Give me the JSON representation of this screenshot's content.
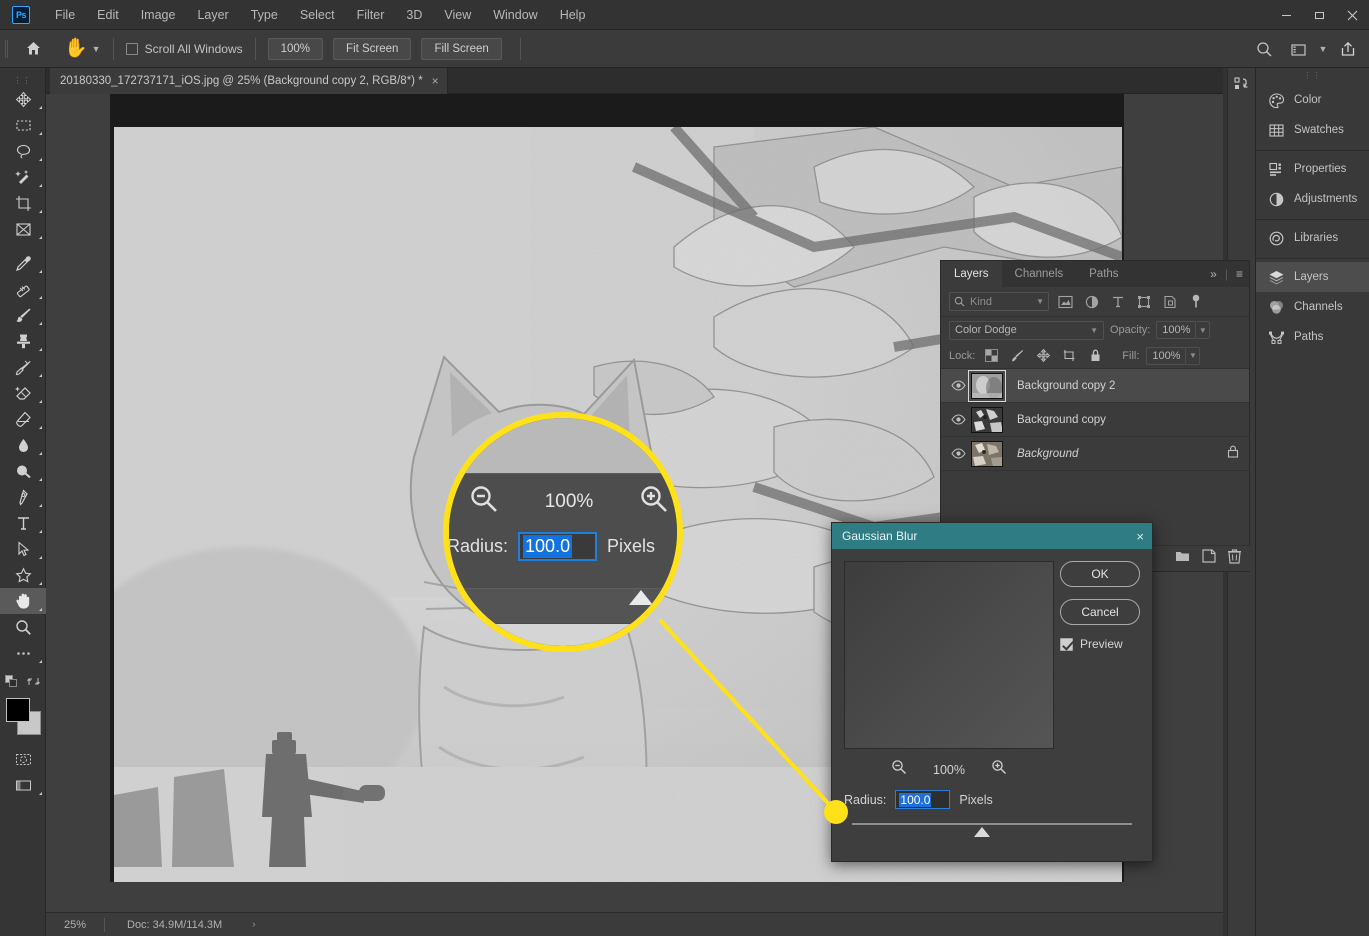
{
  "app": {
    "name": "Adobe Photoshop",
    "logo_text": "Ps"
  },
  "menubar": {
    "items": [
      "File",
      "Edit",
      "Image",
      "Layer",
      "Type",
      "Select",
      "Filter",
      "3D",
      "View",
      "Window",
      "Help"
    ],
    "window_controls": [
      "minimize",
      "maximize",
      "close"
    ]
  },
  "options_bar": {
    "home_icon": "home-icon",
    "active_tool": "hand-tool",
    "scroll_all_windows_label": "Scroll All Windows",
    "scroll_all_windows_checked": false,
    "zoom_100_label": "100%",
    "fit_screen_label": "Fit Screen",
    "fill_screen_label": "Fill Screen",
    "right_icons": [
      "search-icon",
      "workspace-icon",
      "share-icon"
    ]
  },
  "toolbar": {
    "tools": [
      {
        "name": "move-tool",
        "active": false
      },
      {
        "name": "rectangular-marquee-tool",
        "active": false
      },
      {
        "name": "lasso-tool",
        "active": false
      },
      {
        "name": "quick-selection-tool",
        "active": false
      },
      {
        "name": "crop-tool",
        "active": false
      },
      {
        "name": "frame-tool",
        "active": false
      },
      {
        "name": "eyedropper-tool",
        "active": false
      },
      {
        "name": "spot-healing-brush-tool",
        "active": false
      },
      {
        "name": "brush-tool",
        "active": false
      },
      {
        "name": "clone-stamp-tool",
        "active": false
      },
      {
        "name": "history-brush-tool",
        "active": false
      },
      {
        "name": "eraser-tool",
        "active": false
      },
      {
        "name": "gradient-tool",
        "active": false
      },
      {
        "name": "blur-tool",
        "active": false
      },
      {
        "name": "dodge-tool",
        "active": false
      },
      {
        "name": "pen-tool",
        "active": false
      },
      {
        "name": "type-tool",
        "active": false
      },
      {
        "name": "path-selection-tool",
        "active": false
      },
      {
        "name": "custom-shape-tool",
        "active": false
      },
      {
        "name": "hand-tool",
        "active": true
      },
      {
        "name": "zoom-tool",
        "active": false
      },
      {
        "name": "edit-toolbar-tool",
        "active": false
      }
    ],
    "foreground_color": "#000000",
    "background_color": "#c8c8c8",
    "quick_mask_label": "quick-mask-mode"
  },
  "document": {
    "tab_title": "20180330_172737171_iOS.jpg @ 25% (Background copy 2, RGB/8*) *",
    "close_glyph": "×"
  },
  "status_bar": {
    "zoom": "25%",
    "doc_info": "Doc: 34.9M/114.3M",
    "arrow": "›"
  },
  "layers_panel": {
    "tabs": [
      {
        "label": "Layers",
        "active": true
      },
      {
        "label": "Channels",
        "active": false
      },
      {
        "label": "Paths",
        "active": false
      }
    ],
    "collapse_glyph": "»",
    "menu_glyph": "≡",
    "filter": {
      "kind_label": "Kind",
      "search_icon": "search-icon",
      "filter_icons": [
        "pixel-layers-filter-icon",
        "adjustment-layers-filter-icon",
        "type-layers-filter-icon",
        "shape-layers-filter-icon",
        "smart-object-filter-icon",
        "filter-toggle-icon"
      ]
    },
    "blend_mode": "Color Dodge",
    "opacity_label": "Opacity:",
    "opacity_value": "100%",
    "lock_label": "Lock:",
    "lock_icons": [
      "lock-transparent-pixels-icon",
      "lock-image-pixels-icon",
      "lock-position-icon",
      "lock-artboard-icon",
      "lock-all-icon"
    ],
    "fill_label": "Fill:",
    "fill_value": "100%",
    "layers": [
      {
        "name": "Background copy 2",
        "visible": true,
        "selected": true,
        "locked": false,
        "italic": false
      },
      {
        "name": "Background copy",
        "visible": true,
        "selected": false,
        "locked": false,
        "italic": false
      },
      {
        "name": "Background",
        "visible": true,
        "selected": false,
        "locked": true,
        "italic": true
      }
    ],
    "bottom_icons": [
      "new-group-icon",
      "new-layer-icon",
      "delete-layer-icon"
    ]
  },
  "right_rail": {
    "groups": [
      [
        {
          "label": "Color",
          "icon": "color-panel-icon",
          "active": false
        },
        {
          "label": "Swatches",
          "icon": "swatches-panel-icon",
          "active": false
        }
      ],
      [
        {
          "label": "Properties",
          "icon": "properties-panel-icon",
          "active": false
        },
        {
          "label": "Adjustments",
          "icon": "adjustments-panel-icon",
          "active": false
        }
      ],
      [
        {
          "label": "Libraries",
          "icon": "libraries-panel-icon",
          "active": false
        }
      ],
      [
        {
          "label": "Layers",
          "icon": "layers-panel-icon",
          "active": true
        },
        {
          "label": "Channels",
          "icon": "channels-panel-icon",
          "active": false
        },
        {
          "label": "Paths",
          "icon": "paths-panel-icon",
          "active": false
        }
      ]
    ],
    "collapse_icon": "collapse-panels-icon"
  },
  "gaussian_blur_dialog": {
    "title": "Gaussian Blur",
    "close_glyph": "×",
    "ok_label": "OK",
    "cancel_label": "Cancel",
    "preview_label": "Preview",
    "preview_checked": true,
    "zoom_out_icon": "zoom-out-icon",
    "zoom_in_icon": "zoom-in-icon",
    "zoom_value": "100%",
    "radius_label": "Radius:",
    "radius_value": "100.0",
    "radius_units": "Pixels"
  },
  "callout": {
    "zoom_out_icon": "zoom-out-icon",
    "zoom_in_icon": "zoom-in-icon",
    "zoom_value": "100%",
    "radius_label": "Radius:",
    "radius_value": "100.0",
    "radius_units": "Pixels",
    "highlight_color": "#ffe11a"
  },
  "colors": {
    "dialog_title_bar": "#2f7c84",
    "highlight_yellow": "#ffe11a",
    "selection_blue": "#1272e0",
    "panel_bg": "#3b3b3b",
    "app_bg": "#323232",
    "canvas_bg": "#3f3f3f"
  }
}
